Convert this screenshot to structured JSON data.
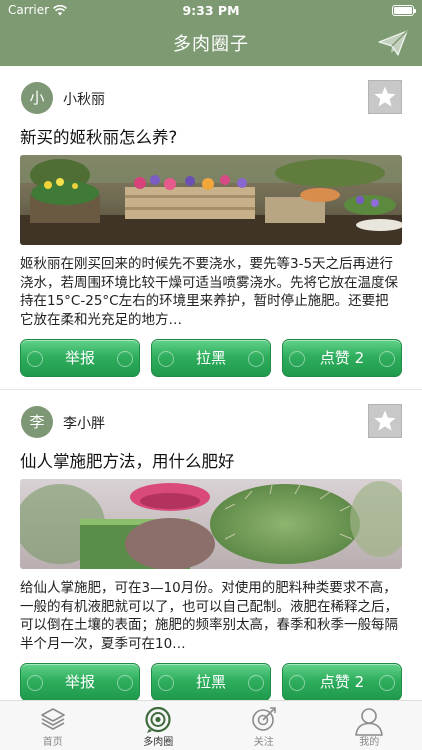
{
  "status": {
    "carrier": "Carrier",
    "time": "9:33 PM"
  },
  "header": {
    "title": "多肉圈子"
  },
  "posts": [
    {
      "avatar": "小",
      "username": "小秋丽",
      "title": "新买的姬秋丽怎么养?",
      "body": "姬秋丽在刚买回来的时候先不要浇水，要先等3-5天之后再进行浇水，若周围环境比较干燥可适当喷雾浇水。先将它放在温度保持在15°C-25°C左右的环境里来养护，暂时停止施肥。还要把它放在柔和光充足的地方…",
      "report_label": "举报",
      "block_label": "拉黑",
      "like_label": "点赞 2"
    },
    {
      "avatar": "李",
      "username": "李小胖",
      "title": "仙人掌施肥方法，用什么肥好",
      "body": "给仙人掌施肥，可在3—10月份。对使用的肥料种类要求不高，一般的有机液肥就可以了，也可以自己配制。液肥在稀释之后，可以倒在土壤的表面；施肥的频率别太高，春季和秋季一般每隔半个月一次，夏季可在10…",
      "report_label": "举报",
      "block_label": "拉黑",
      "like_label": "点赞 2"
    }
  ],
  "tabbar": {
    "tabs": [
      {
        "label": "首页",
        "icon": "layers-icon"
      },
      {
        "label": "多肉圈",
        "icon": "circle-target-icon"
      },
      {
        "label": "关注",
        "icon": "focus-icon"
      },
      {
        "label": "我的",
        "icon": "person-icon"
      }
    ],
    "active_index": 1
  },
  "colors": {
    "header": "#7d9a72",
    "button_green": "#2fae5e",
    "avatar": "#7e9774",
    "favorite_box": "#c8c8c8"
  }
}
